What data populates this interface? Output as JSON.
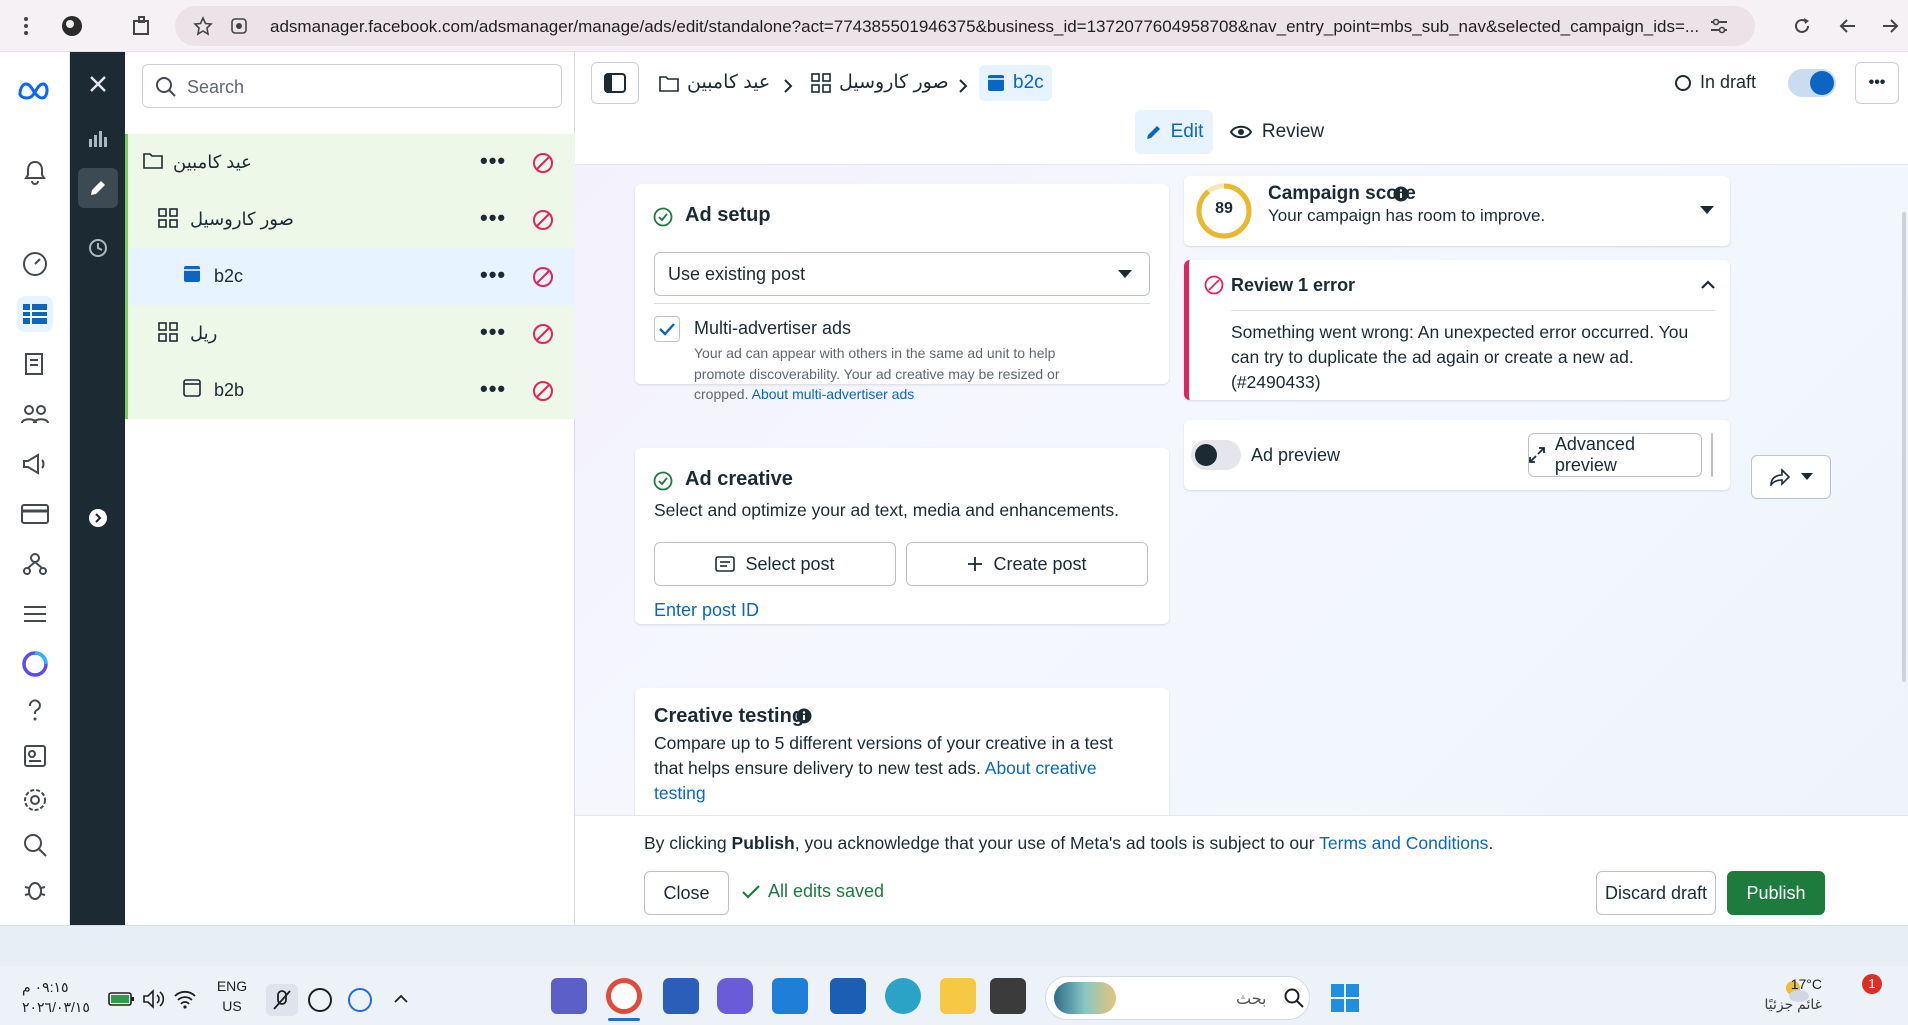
{
  "browser": {
    "url": "adsmanager.facebook.com/adsmanager/manage/ads/edit/standalone?act=774385501946375&business_id=1372077604958708&nav_entry_point=mbs_sub_nav&selected_campaign_ids=..."
  },
  "tree": {
    "search_placeholder": "Search",
    "rows": [
      {
        "label": "عيد كامبين",
        "type": "campaign"
      },
      {
        "label": "صور كاروسيل",
        "type": "adset"
      },
      {
        "label": "b2c",
        "type": "ad",
        "selected": true
      },
      {
        "label": "ريل",
        "type": "adset"
      },
      {
        "label": "b2b",
        "type": "ad"
      }
    ]
  },
  "header": {
    "breadcrumbs": [
      "عيد كامبين",
      "صور كاروسيل",
      "b2c"
    ],
    "status": "In draft",
    "edit_label": "Edit",
    "review_label": "Review"
  },
  "ad_setup": {
    "title": "Ad setup",
    "dropdown_value": "Use existing post",
    "multi_advertiser_label": "Multi-advertiser ads",
    "multi_advertiser_desc": "Your ad can appear with others in the same ad unit to help promote discoverability. Your ad creative may be resized or cropped.",
    "multi_advertiser_link": "About multi-advertiser ads"
  },
  "ad_creative": {
    "title": "Ad creative",
    "desc": "Select and optimize your ad text, media and enhancements.",
    "select_post": "Select post",
    "create_post": "Create post",
    "enter_post_id": "Enter post ID"
  },
  "creative_testing": {
    "title": "Creative testing",
    "desc": "Compare up to 5 different versions of your creative in a test that helps ensure delivery to new test ads.",
    "link": "About creative testing"
  },
  "campaign_score": {
    "score": "89",
    "title": "Campaign score",
    "subtitle": "Your campaign has room to improve."
  },
  "errors": {
    "title": "Review 1 error",
    "message": "Something went wrong: An unexpected error occurred. You can try to duplicate the ad again or create a new ad. (#2490433)"
  },
  "preview": {
    "label": "Ad preview",
    "advanced": "Advanced preview"
  },
  "footer": {
    "notice_pre": "By clicking ",
    "notice_bold": "Publish",
    "notice_mid": ", you acknowledge that your use of Meta's ad tools is subject to our ",
    "notice_link": "Terms and Conditions",
    "notice_end": ".",
    "close": "Close",
    "saved": "All edits saved",
    "discard": "Discard draft",
    "publish": "Publish"
  },
  "taskbar": {
    "time": "٠٩:١٥ م",
    "date": "٢٠٢٦/٠٣/١٥",
    "lang_top": "ENG",
    "lang_bottom": "US",
    "search_text": "بحث",
    "weather_temp": "17°C",
    "weather_desc": "غائم جزئيًا",
    "notif_count": "1"
  },
  "colors": {
    "primary_blue": "#0a66c2",
    "publish_green": "#1e7b3e",
    "error_red": "#e0245e",
    "dark_rail": "#1c2b33"
  }
}
